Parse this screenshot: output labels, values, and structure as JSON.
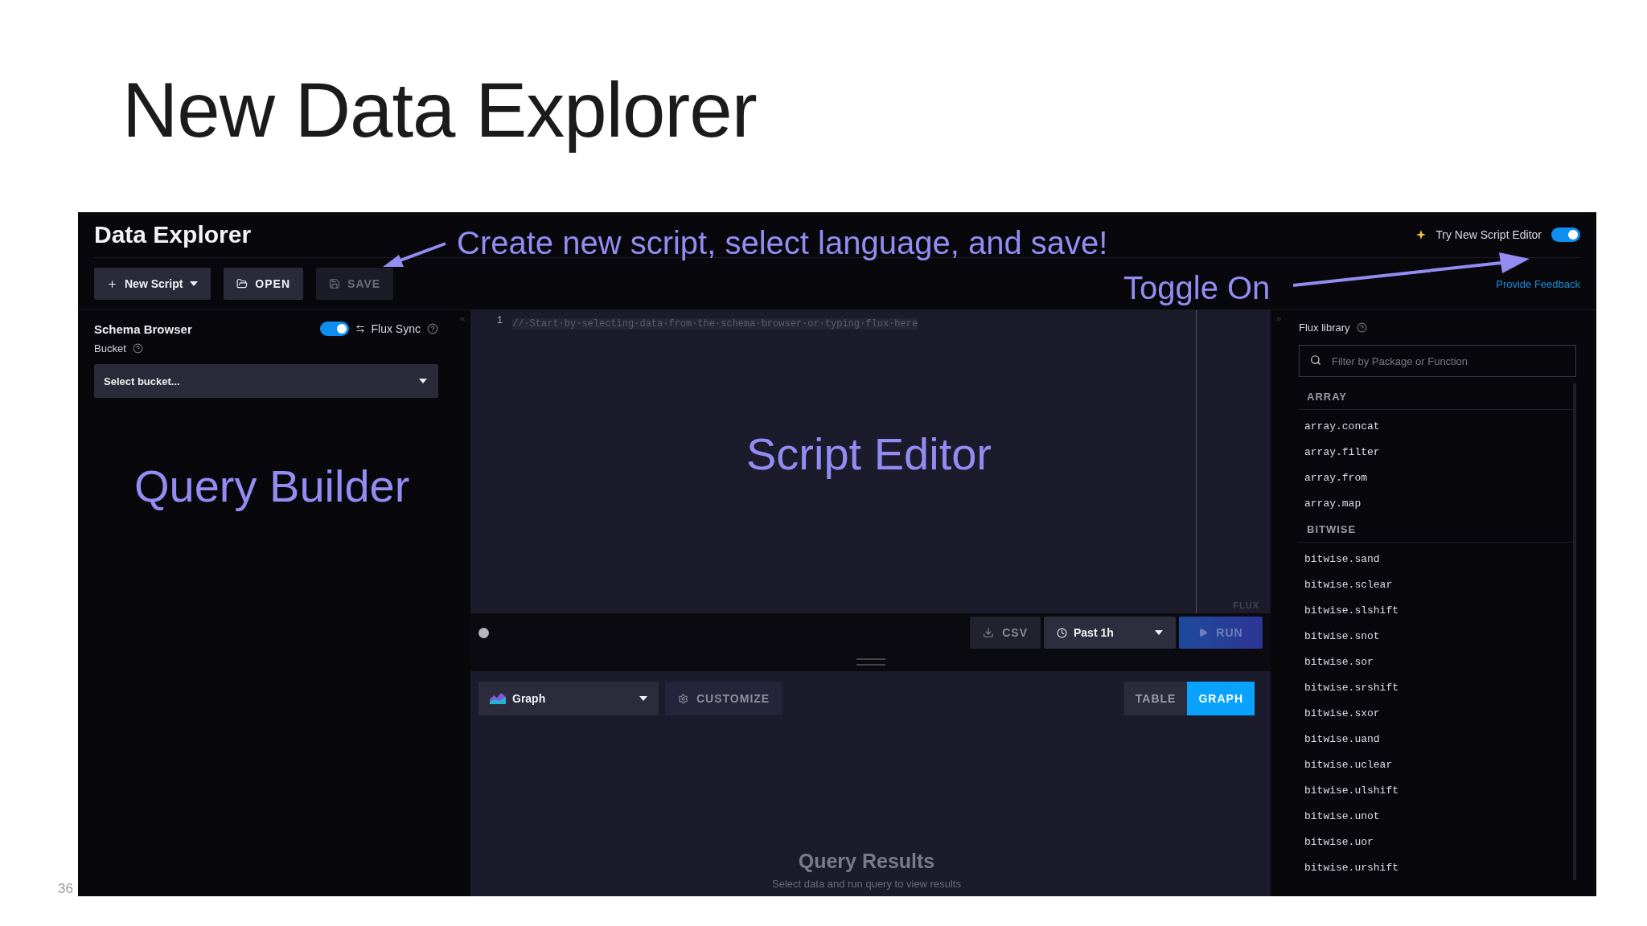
{
  "slide": {
    "title": "New Data Explorer",
    "page_number": "36"
  },
  "app": {
    "title": "Data Explorer",
    "toolbar": [
      {
        "label": "New Script",
        "kind": "new",
        "disabled": false
      },
      {
        "label": "OPEN",
        "kind": "open",
        "disabled": false
      },
      {
        "label": "SAVE",
        "kind": "save",
        "disabled": true
      }
    ],
    "new_editor_toggle": {
      "label": "Try New Script Editor",
      "on": true
    },
    "feedback_link": "Provide Feedback",
    "schema_browser": {
      "title": "Schema Browser",
      "flux_sync": {
        "label": "Flux Sync",
        "on": true
      },
      "bucket_label": "Bucket",
      "bucket_select": "Select bucket..."
    },
    "editor": {
      "lines": [
        {
          "number": "1",
          "text": "//·Start·by·selecting·data·from·the·schema·browser·or·typing·flux·here"
        }
      ],
      "language": "FLUX"
    },
    "run_bar": {
      "csv": "CSV",
      "time_range": "Past 1h",
      "run": "RUN"
    },
    "results": {
      "view_type": "Graph",
      "customize": "CUSTOMIZE",
      "modes": [
        {
          "label": "TABLE",
          "selected": false
        },
        {
          "label": "GRAPH",
          "selected": true
        }
      ],
      "empty_title": "Query Results",
      "empty_text": "Select data and run query to view results"
    },
    "flux_library": {
      "title": "Flux library",
      "search": {
        "placeholder": "Filter by Package or Function"
      },
      "groups": [
        {
          "name": "ARRAY",
          "functions": [
            "array.concat",
            "array.filter",
            "array.from",
            "array.map"
          ]
        },
        {
          "name": "BITWISE",
          "functions": [
            "bitwise.sand",
            "bitwise.sclear",
            "bitwise.slshift",
            "bitwise.snot",
            "bitwise.sor",
            "bitwise.srshift",
            "bitwise.sxor",
            "bitwise.uand",
            "bitwise.uclear",
            "bitwise.ulshift",
            "bitwise.unot",
            "bitwise.uor",
            "bitwise.urshift"
          ]
        }
      ]
    }
  },
  "annotations": [
    {
      "text": "Create new script, select language, and save!",
      "kind": "arrow-left"
    },
    {
      "text": "Toggle On",
      "kind": "arrow-right"
    },
    {
      "text": "Script Editor",
      "kind": "editor"
    },
    {
      "text": "Query Builder",
      "kind": "builder"
    }
  ]
}
